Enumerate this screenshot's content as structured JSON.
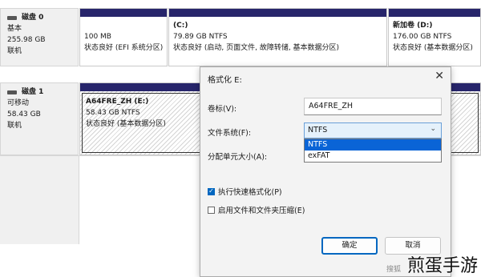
{
  "disks": [
    {
      "name": "磁盘 0",
      "type": "基本",
      "size": "255.98 GB",
      "status": "联机",
      "partitions": [
        {
          "title": "",
          "size": "100 MB",
          "desc": "状态良好 (EFI 系统分区)"
        },
        {
          "title": "(C:)",
          "size": "79.89 GB NTFS",
          "desc": "状态良好 (启动, 页面文件, 故障转储, 基本数据分区)"
        },
        {
          "title": "新加卷  (D:)",
          "size": "176.00 GB NTFS",
          "desc": "状态良好 (基本数据分区)"
        }
      ]
    },
    {
      "name": "磁盘 1",
      "type": "可移动",
      "size": "58.43 GB",
      "status": "联机",
      "partitions": [
        {
          "title": "A64FRE_ZH  (E:)",
          "size": "58.43 GB NTFS",
          "desc": "状态良好 (基本数据分区)"
        }
      ]
    }
  ],
  "dialog": {
    "title": "格式化 E:",
    "close_glyph": "✕",
    "volume_label_text": "卷标(V):",
    "volume_label_value": "A64FRE_ZH",
    "filesystem_text": "文件系统(F):",
    "filesystem_value": "NTFS",
    "filesystem_options": [
      "NTFS",
      "exFAT"
    ],
    "alloc_unit_text": "分配单元大小(A):",
    "quick_format_text": "执行快速格式化(P)",
    "quick_format_checked": true,
    "compression_text": "启用文件和文件夹压缩(E)",
    "compression_checked": false,
    "ok_label": "确定",
    "cancel_label": "取消"
  },
  "watermark": {
    "text": "煎蛋手游",
    "small_text": "搜狐"
  },
  "icons": {
    "disk": "disk-icon",
    "close": "close-icon",
    "dropdown": "chevron-down-icon",
    "checkmark": "check-icon"
  },
  "colors": {
    "partition_bar": "#27256b",
    "accent": "#0067c0",
    "selected_option": "#0a64d6"
  }
}
